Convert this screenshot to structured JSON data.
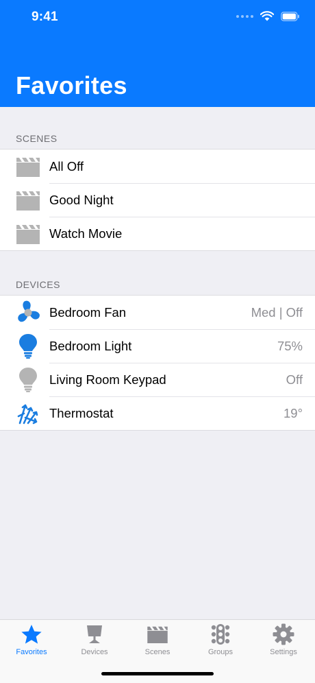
{
  "status_bar": {
    "time": "9:41"
  },
  "header": {
    "title": "Favorites"
  },
  "scenes": {
    "header": "SCENES",
    "items": [
      {
        "label": "All Off",
        "icon": "clapperboard-icon"
      },
      {
        "label": "Good Night",
        "icon": "clapperboard-icon"
      },
      {
        "label": "Watch Movie",
        "icon": "clapperboard-icon"
      }
    ]
  },
  "devices": {
    "header": "DEVICES",
    "items": [
      {
        "label": "Bedroom Fan",
        "value": "Med | Off",
        "icon": "fan-icon"
      },
      {
        "label": "Bedroom Light",
        "value": "75%",
        "icon": "lightbulb-on-icon"
      },
      {
        "label": "Living Room Keypad",
        "value": "Off",
        "icon": "lightbulb-off-icon"
      },
      {
        "label": "Thermostat",
        "value": "19°",
        "icon": "snowflake-icon"
      }
    ]
  },
  "tabbar": {
    "tabs": [
      {
        "label": "Favorites",
        "icon": "star-icon",
        "active": true
      },
      {
        "label": "Devices",
        "icon": "lamp-icon",
        "active": false
      },
      {
        "label": "Scenes",
        "icon": "clapperboard-icon",
        "active": false
      },
      {
        "label": "Groups",
        "icon": "dots-grid-icon",
        "active": false
      },
      {
        "label": "Settings",
        "icon": "gear-icon",
        "active": false
      }
    ]
  },
  "colors": {
    "accent": "#0a7aff",
    "icon_gray": "#b4b4b4",
    "device_blue": "#1a7de0",
    "secondary_text": "#8e8e93",
    "background": "#efeff4"
  }
}
